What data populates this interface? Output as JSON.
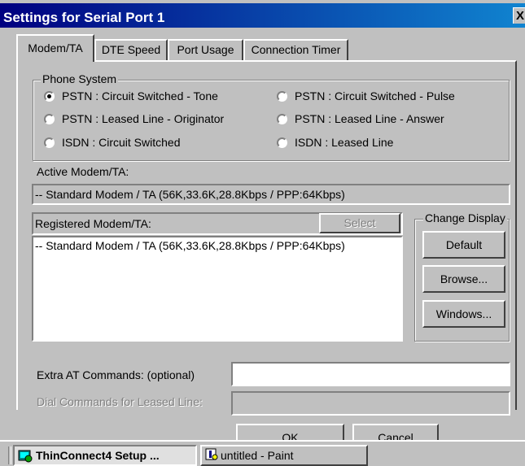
{
  "window": {
    "title": "Settings for Serial Port 1",
    "close_glyph": "X"
  },
  "tabs": [
    {
      "label": "Modem/TA",
      "active": true
    },
    {
      "label": "DTE Speed",
      "active": false
    },
    {
      "label": "Port Usage",
      "active": false
    },
    {
      "label": "Connection Timer",
      "active": false
    }
  ],
  "phone_system": {
    "legend": "Phone System",
    "options": [
      {
        "label": "PSTN : Circuit Switched - Tone",
        "selected": true
      },
      {
        "label": "PSTN : Circuit Switched - Pulse",
        "selected": false
      },
      {
        "label": "PSTN : Leased Line - Originator",
        "selected": false
      },
      {
        "label": "PSTN : Leased Line - Answer",
        "selected": false
      },
      {
        "label": "ISDN : Circuit Switched",
        "selected": false
      },
      {
        "label": "ISDN : Leased Line",
        "selected": false
      }
    ]
  },
  "active_modem": {
    "label": "Active Modem/TA:",
    "value": "-- Standard Modem / TA (56K,33.6K,28.8Kbps / PPP:64Kbps)"
  },
  "registered_modem": {
    "label": "Registered Modem/TA:",
    "select_button": "Select",
    "items": [
      "-- Standard Modem / TA (56K,33.6K,28.8Kbps / PPP:64Kbps)"
    ]
  },
  "change_display": {
    "legend": "Change Display",
    "default_button": "Default",
    "browse_button": "Browse...",
    "windows_button": "Windows..."
  },
  "extra_at": {
    "label": "Extra AT Commands: (optional)",
    "value": ""
  },
  "dial_commands": {
    "label": "Dial Commands for Leased Line:",
    "value": ""
  },
  "footer": {
    "ok_button": "OK",
    "cancel_button": "Cancel"
  },
  "taskbar": {
    "items": [
      {
        "label": "ThinConnect4 Setup ...",
        "icon": "setup-icon"
      },
      {
        "label": "untitled - Paint",
        "icon": "paint-icon"
      }
    ]
  }
}
